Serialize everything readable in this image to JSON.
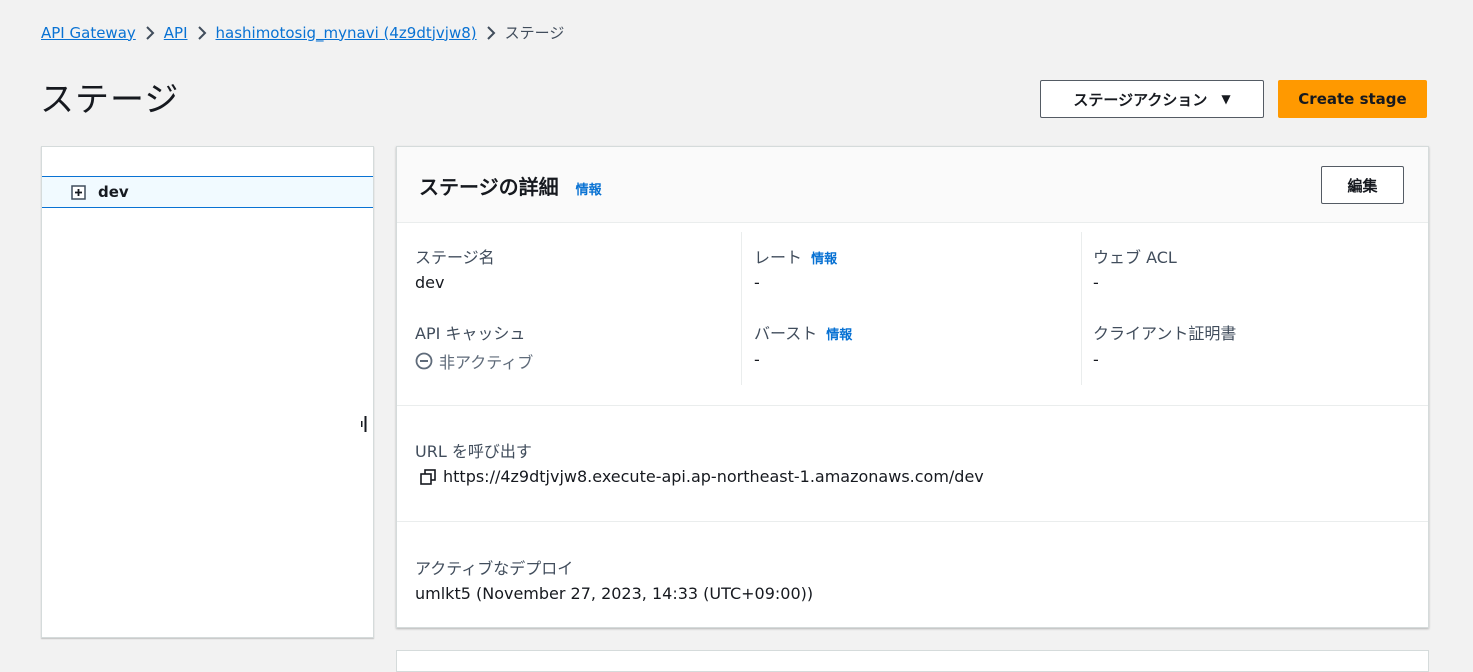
{
  "breadcrumb": {
    "items": [
      "API Gateway",
      "API",
      "hashimotosig_mynavi (4z9dtjvjw8)"
    ],
    "current": "ステージ"
  },
  "page": {
    "title": "ステージ",
    "actions_label": "ステージアクション",
    "create_label": "Create stage"
  },
  "tree": {
    "items": [
      {
        "label": "dev"
      }
    ]
  },
  "details": {
    "title": "ステージの詳細",
    "info": "情報",
    "edit_label": "編集",
    "fields": {
      "stage_name": {
        "label": "ステージ名",
        "value": "dev"
      },
      "rate": {
        "label": "レート",
        "info": "情報",
        "value": "-"
      },
      "web_acl": {
        "label": "ウェブ ACL",
        "value": "-"
      },
      "api_cache": {
        "label": "API キャッシュ",
        "value": "非アクティブ"
      },
      "burst": {
        "label": "バースト",
        "info": "情報",
        "value": "-"
      },
      "client_cert": {
        "label": "クライアント証明書",
        "value": "-"
      }
    },
    "invoke_url": {
      "label": "URL を呼び出す",
      "value": "https://4z9dtjvjw8.execute-api.ap-northeast-1.amazonaws.com/dev"
    },
    "active_deploy": {
      "label": "アクティブなデプロイ",
      "value": "umlkt5 (November 27, 2023, 14:33 (UTC+09:00))"
    }
  },
  "colors": {
    "link": "#0972d3",
    "primary": "#ff9900",
    "background": "#f2f2f2",
    "selected_row": "#f1faff"
  },
  "icons": [
    "chevron-right-icon",
    "caret-down-icon",
    "expand-plus-icon",
    "resize-handle-icon",
    "inactive-minus-icon",
    "copy-icon"
  ]
}
